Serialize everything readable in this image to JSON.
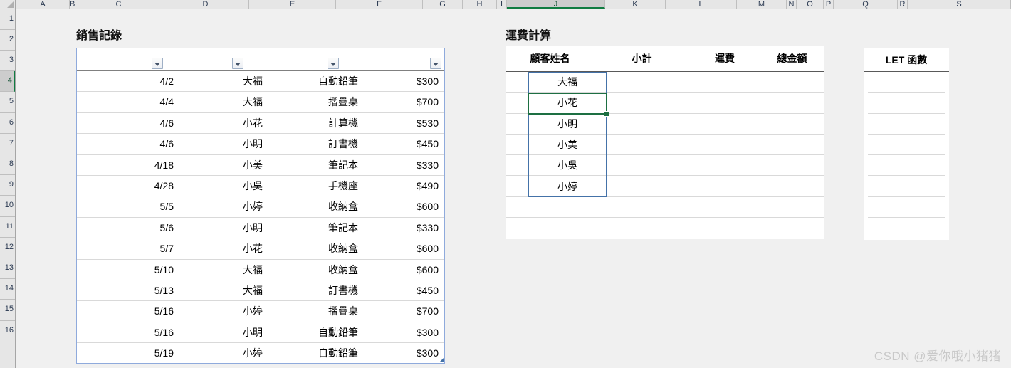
{
  "app": {
    "background_color": "#f0f0f0",
    "accent_selection_color": "#107c41",
    "table_border_color": "#8faadc",
    "active_cell_border_color": "#1d6f42"
  },
  "grid": {
    "column_letters": [
      "A",
      "B",
      "C",
      "D",
      "E",
      "F",
      "G",
      "H",
      "I",
      "J",
      "K",
      "L",
      "M",
      "N",
      "O",
      "P",
      "Q",
      "R",
      "S"
    ],
    "selected_column": "J",
    "row_numbers": [
      "1",
      "2",
      "3",
      "4",
      "5",
      "6",
      "7",
      "8",
      "9",
      "10",
      "11",
      "12",
      "13",
      "14",
      "15",
      "16"
    ],
    "selected_row": "4"
  },
  "sales_section": {
    "title": "銷售記錄",
    "header_labels": [
      "",
      "",
      "",
      ""
    ],
    "filter_icon": "filter-dropdown-icon",
    "rows": [
      {
        "date": "4/2",
        "customer": "大福",
        "item": "自動鉛筆",
        "amount": "$300"
      },
      {
        "date": "4/4",
        "customer": "大福",
        "item": "摺疊桌",
        "amount": "$700"
      },
      {
        "date": "4/6",
        "customer": "小花",
        "item": "計算機",
        "amount": "$530"
      },
      {
        "date": "4/6",
        "customer": "小明",
        "item": "訂書機",
        "amount": "$450"
      },
      {
        "date": "4/18",
        "customer": "小美",
        "item": "筆記本",
        "amount": "$330"
      },
      {
        "date": "4/28",
        "customer": "小吳",
        "item": "手機座",
        "amount": "$490"
      },
      {
        "date": "5/5",
        "customer": "小婷",
        "item": "收納盒",
        "amount": "$600"
      },
      {
        "date": "5/6",
        "customer": "小明",
        "item": "筆記本",
        "amount": "$330"
      },
      {
        "date": "5/7",
        "customer": "小花",
        "item": "收納盒",
        "amount": "$600"
      },
      {
        "date": "5/10",
        "customer": "大福",
        "item": "收納盒",
        "amount": "$600"
      },
      {
        "date": "5/13",
        "customer": "大福",
        "item": "訂書機",
        "amount": "$450"
      },
      {
        "date": "5/16",
        "customer": "小婷",
        "item": "摺疊桌",
        "amount": "$700"
      },
      {
        "date": "5/16",
        "customer": "小明",
        "item": "自動鉛筆",
        "amount": "$300"
      },
      {
        "date": "5/19",
        "customer": "小婷",
        "item": "自動鉛筆",
        "amount": "$300"
      }
    ]
  },
  "shipping_section": {
    "title": "運費計算",
    "headers": [
      "顧客姓名",
      "小計",
      "運費",
      "總金額"
    ],
    "rows": [
      {
        "customer": "大福",
        "subtotal": "",
        "shipping": "",
        "total": ""
      },
      {
        "customer": "小花",
        "subtotal": "",
        "shipping": "",
        "total": ""
      },
      {
        "customer": "小明",
        "subtotal": "",
        "shipping": "",
        "total": ""
      },
      {
        "customer": "小美",
        "subtotal": "",
        "shipping": "",
        "total": ""
      },
      {
        "customer": "小吳",
        "subtotal": "",
        "shipping": "",
        "total": ""
      },
      {
        "customer": "小婷",
        "subtotal": "",
        "shipping": "",
        "total": ""
      }
    ],
    "active_cell_value": "小花",
    "extra_empty_rows": 2
  },
  "let_section": {
    "title": "LET 函數",
    "empty_row_count": 8
  },
  "watermark": {
    "text": "CSDN @爱你哦小猪猪"
  }
}
